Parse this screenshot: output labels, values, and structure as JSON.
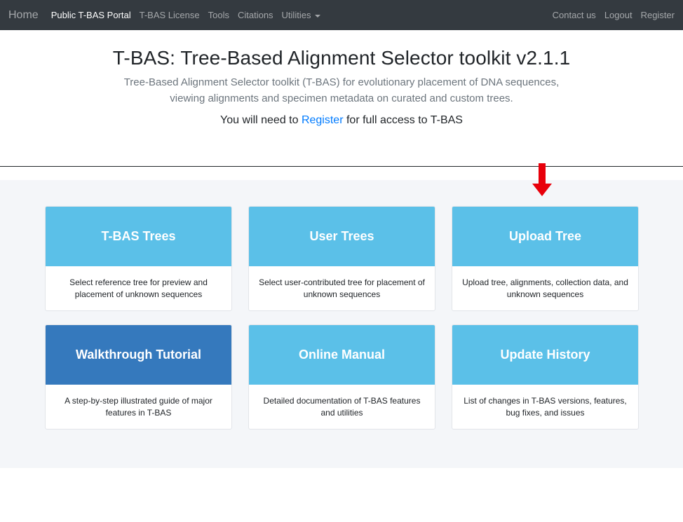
{
  "navbar": {
    "brand": "Home",
    "items": [
      {
        "label": "Public T-BAS Portal"
      },
      {
        "label": "T-BAS License"
      },
      {
        "label": "Tools"
      },
      {
        "label": "Citations"
      },
      {
        "label": "Utilities"
      }
    ],
    "right": [
      {
        "label": "Contact us"
      },
      {
        "label": "Logout"
      },
      {
        "label": "Register"
      }
    ]
  },
  "header": {
    "title": "T-BAS: Tree-Based Alignment Selector toolkit v2.1.1",
    "subtitle": "Tree-Based Alignment Selector toolkit (T-BAS) for evolutionary placement of DNA sequences, viewing alignments and specimen metadata on curated and custom trees.",
    "register_prefix": "You will need to ",
    "register_link": "Register",
    "register_suffix": " for full access to T-BAS"
  },
  "cards": [
    {
      "title": "T-BAS Trees",
      "text": "Select reference tree for preview and placement of unknown sequences"
    },
    {
      "title": "User Trees",
      "text": "Select user-contributed tree for placement of unknown sequences"
    },
    {
      "title": "Upload Tree",
      "text": "Upload tree, alignments, collection data, and unknown sequences"
    },
    {
      "title": "Walkthrough Tutorial",
      "text": "A step-by-step illustrated guide of major features in T-BAS"
    },
    {
      "title": "Online Manual",
      "text": "Detailed documentation of T-BAS features and utilities"
    },
    {
      "title": "Update History",
      "text": "List of changes in T-BAS versions, features, bug fixes, and issues"
    }
  ],
  "colors": {
    "navbar_bg": "#343a40",
    "card_header": "#5bc0e8",
    "card_header_highlight": "#3579bd",
    "link": "#007bff",
    "annotation_arrow": "#e8000b"
  },
  "icons": {
    "dropdown": "caret-down-icon",
    "annotation": "red-down-arrow-icon"
  }
}
